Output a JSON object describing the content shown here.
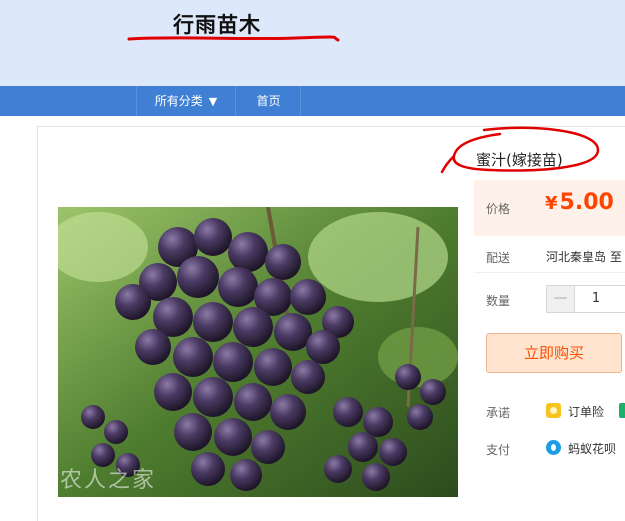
{
  "store": {
    "title": "行雨苗木"
  },
  "nav": {
    "all_categories": "所有分类",
    "home": "首页"
  },
  "product": {
    "title": "蜜汁(嫁接苗)",
    "price_label": "价格",
    "currency": "¥",
    "price": "5.00",
    "shipping_label": "配送",
    "shipping_value": "河北秦皇岛 至",
    "quantity_label": "数量",
    "quantity": "1",
    "buy_now": "立即购买",
    "promise_label": "承诺",
    "promise_value": "订单险",
    "payment_label": "支付",
    "payment_value": "蚂蚁花呗"
  },
  "watermark": "农人之家",
  "colors": {
    "price": "#ff4400",
    "nav": "#3f7fd4",
    "header": "#dde9fb",
    "annotation": "#e00000"
  },
  "icons": {
    "dropdown": "caret-down-icon",
    "promise": "insurance-icon",
    "payment": "huabei-icon"
  }
}
